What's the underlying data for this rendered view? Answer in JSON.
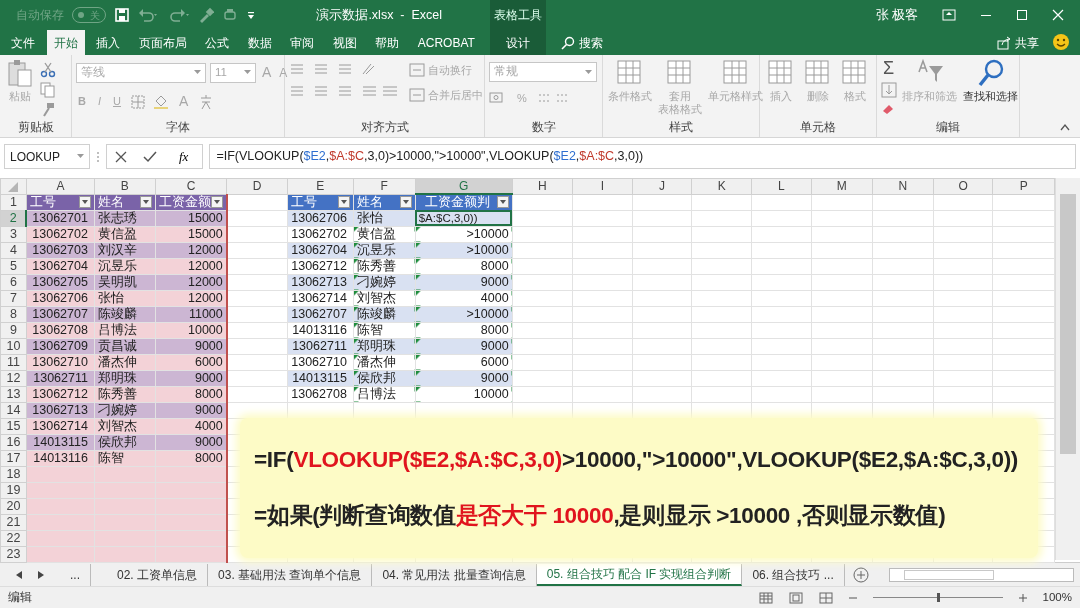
{
  "window": {
    "autosave_label": "自动保存",
    "autosave_state": "关",
    "autosave_on": false,
    "title": "演示数据.xlsx  -  Excel",
    "context_group": "表格工具",
    "user": "张 极客"
  },
  "ribbon_tabs": [
    {
      "label": "文件",
      "selected": false,
      "kind": "normal"
    },
    {
      "label": "开始",
      "selected": true,
      "kind": "normal"
    },
    {
      "label": "插入",
      "selected": false,
      "kind": "normal"
    },
    {
      "label": "页面布局",
      "selected": false,
      "kind": "normal"
    },
    {
      "label": "公式",
      "selected": false,
      "kind": "normal"
    },
    {
      "label": "数据",
      "selected": false,
      "kind": "normal"
    },
    {
      "label": "审阅",
      "selected": false,
      "kind": "normal"
    },
    {
      "label": "视图",
      "selected": false,
      "kind": "normal"
    },
    {
      "label": "帮助",
      "selected": false,
      "kind": "normal"
    },
    {
      "label": "ACROBAT",
      "selected": false,
      "kind": "normal"
    },
    {
      "label": "设计",
      "selected": false,
      "kind": "contextual"
    }
  ],
  "search": "搜索",
  "share": "共享",
  "ribbon_groups": [
    {
      "name": "剪贴板",
      "kind": "clipboard",
      "items": [
        {
          "lines": [
            "粘贴"
          ],
          "disabled": true
        }
      ]
    },
    {
      "name": "字体",
      "kind": "font",
      "font": "等线",
      "size": "11",
      "grow_shrink": [
        "A",
        "A"
      ],
      "styles": [
        "B",
        "I",
        "U"
      ],
      "color_letter": "A",
      "disabled": true
    },
    {
      "name": "对齐方式",
      "kind": "align",
      "items": [
        {
          "lines": [
            "自动换行"
          ],
          "disabled": true
        },
        {
          "lines": [
            "合并后居中"
          ],
          "disabled": true
        }
      ]
    },
    {
      "name": "数字",
      "kind": "number",
      "format": "常规",
      "percent": "%",
      "disabled": true
    },
    {
      "name": "样式",
      "kind": "buttons",
      "items": [
        {
          "lines": [
            "条件格式"
          ],
          "disabled": true
        },
        {
          "lines": [
            "套用",
            "表格格式"
          ],
          "disabled": true
        },
        {
          "lines": [
            "单元格样式"
          ],
          "disabled": true
        }
      ]
    },
    {
      "name": "单元格",
      "kind": "buttons",
      "items": [
        {
          "lines": [
            "插入"
          ],
          "disabled": true
        },
        {
          "lines": [
            "删除"
          ],
          "disabled": true
        },
        {
          "lines": [
            "格式"
          ],
          "disabled": true
        }
      ]
    },
    {
      "name": "编辑",
      "kind": "editing",
      "autosum": "Σ",
      "items": [
        {
          "lines": [
            "排序和筛选"
          ],
          "disabled": true
        },
        {
          "lines": [
            "查找和选择"
          ],
          "disabled": false
        }
      ]
    }
  ],
  "formula_bar": {
    "name_box": "LOOKUP",
    "function_button": "fx",
    "parts": [
      {
        "text": "=IF(VLOOKUP(",
        "kind": "plain"
      },
      {
        "text": "$E2",
        "kind": "ref_blue"
      },
      {
        "text": ",",
        "kind": "plain"
      },
      {
        "text": "$A:$C",
        "kind": "ref_red"
      },
      {
        "text": ",3,0)>10000,\">10000\",VLOOKUP(",
        "kind": "plain"
      },
      {
        "text": "$E2",
        "kind": "ref_blue"
      },
      {
        "text": ",",
        "kind": "plain"
      },
      {
        "text": "$A:$C",
        "kind": "ref_red"
      },
      {
        "text": ",3,0))",
        "kind": "plain"
      }
    ]
  },
  "columns": [
    {
      "label": "A",
      "selected": false
    },
    {
      "label": "B",
      "selected": false
    },
    {
      "label": "C",
      "selected": false
    },
    {
      "label": "D",
      "selected": false
    },
    {
      "label": "E",
      "selected": false
    },
    {
      "label": "F",
      "selected": false
    },
    {
      "label": "G",
      "selected": true
    },
    {
      "label": "H",
      "selected": false
    },
    {
      "label": "I",
      "selected": false
    },
    {
      "label": "J",
      "selected": false
    },
    {
      "label": "K",
      "selected": false
    },
    {
      "label": "L",
      "selected": false
    },
    {
      "label": "M",
      "selected": false
    },
    {
      "label": "N",
      "selected": false
    },
    {
      "label": "O",
      "selected": false
    },
    {
      "label": "P",
      "selected": false
    }
  ],
  "row_headers": [
    {
      "label": "1",
      "selected": false
    },
    {
      "label": "2",
      "selected": true
    },
    {
      "label": "3",
      "selected": false
    },
    {
      "label": "4",
      "selected": false
    },
    {
      "label": "5",
      "selected": false
    },
    {
      "label": "6",
      "selected": false
    },
    {
      "label": "7",
      "selected": false
    },
    {
      "label": "8",
      "selected": false
    },
    {
      "label": "9",
      "selected": false
    },
    {
      "label": "10",
      "selected": false
    },
    {
      "label": "11",
      "selected": false
    },
    {
      "label": "12",
      "selected": false
    },
    {
      "label": "13",
      "selected": false
    },
    {
      "label": "14",
      "selected": false
    },
    {
      "label": "15",
      "selected": false
    },
    {
      "label": "16",
      "selected": false
    },
    {
      "label": "17",
      "selected": false
    },
    {
      "label": "18",
      "selected": false
    },
    {
      "label": "19",
      "selected": false
    },
    {
      "label": "20",
      "selected": false
    },
    {
      "label": "21",
      "selected": false
    },
    {
      "label": "22",
      "selected": false
    },
    {
      "label": "23",
      "selected": false
    }
  ],
  "tables": [
    {
      "columns": [
        "工号",
        "姓名",
        "工资金额"
      ],
      "rows": [
        {
          "cells": [
            "13062701",
            "张志琇",
            "15000"
          ]
        },
        {
          "cells": [
            "13062702",
            "黄信盈",
            "15000"
          ]
        },
        {
          "cells": [
            "13062703",
            "刘汉辛",
            "12000"
          ]
        },
        {
          "cells": [
            "13062704",
            "沉昱乐",
            "12000"
          ]
        },
        {
          "cells": [
            "13062705",
            "吴明凯",
            "12000"
          ]
        },
        {
          "cells": [
            "13062706",
            "张怡",
            "12000"
          ]
        },
        {
          "cells": [
            "13062707",
            "陈竣麟",
            "11000"
          ]
        },
        {
          "cells": [
            "13062708",
            "吕博法",
            "10000"
          ]
        },
        {
          "cells": [
            "13062709",
            "贡昌诚",
            "9000"
          ]
        },
        {
          "cells": [
            "13062710",
            "潘杰伸",
            "6000"
          ]
        },
        {
          "cells": [
            "13062711",
            "郑明珠",
            "9000"
          ]
        },
        {
          "cells": [
            "13062712",
            "陈秀善",
            "8000"
          ]
        },
        {
          "cells": [
            "13062713",
            "刁婉婷",
            "9000"
          ]
        },
        {
          "cells": [
            "13062714",
            "刘智杰",
            "4000"
          ]
        },
        {
          "cells": [
            "14013115",
            "侯欣邦",
            "9000"
          ]
        },
        {
          "cells": [
            "14013116",
            "陈智",
            "8000"
          ]
        }
      ]
    },
    {
      "columns": [
        "工号",
        "姓名",
        "工资金额判"
      ],
      "rows": [
        {
          "cells": [
            "13062706",
            "张怡",
            "$A:$C,3,0))"
          ],
          "flagged": false,
          "editing": true
        },
        {
          "cells": [
            "13062702",
            "黄信盈",
            ">10000"
          ],
          "flagged": true,
          "editing": false
        },
        {
          "cells": [
            "13062704",
            "沉昱乐",
            ">10000"
          ],
          "flagged": true,
          "editing": false
        },
        {
          "cells": [
            "13062712",
            "陈秀善",
            "8000"
          ],
          "flagged": true,
          "editing": false
        },
        {
          "cells": [
            "13062713",
            "刁婉婷",
            "9000"
          ],
          "flagged": true,
          "editing": false
        },
        {
          "cells": [
            "13062714",
            "刘智杰",
            "4000"
          ],
          "flagged": true,
          "editing": false
        },
        {
          "cells": [
            "13062707",
            "陈竣麟",
            ">10000"
          ],
          "flagged": true,
          "editing": false
        },
        {
          "cells": [
            "14013116",
            "陈智",
            "8000"
          ],
          "flagged": true,
          "editing": false
        },
        {
          "cells": [
            "13062711",
            "郑明珠",
            "9000"
          ],
          "flagged": true,
          "editing": false
        },
        {
          "cells": [
            "13062710",
            "潘杰伸",
            "6000"
          ],
          "flagged": true,
          "editing": false
        },
        {
          "cells": [
            "14013115",
            "侯欣邦",
            "9000"
          ],
          "flagged": true,
          "editing": false
        },
        {
          "cells": [
            "13062708",
            "吕博法",
            "10000"
          ],
          "flagged": true,
          "editing": false
        }
      ]
    }
  ],
  "annotation": {
    "lines": [
      [
        {
          "text": "=IF(",
          "emphasis": false
        },
        {
          "text": "VLOOKUP($E2,$A:$C,3,0)",
          "emphasis": true
        },
        {
          "text": ">10000,\">10000\",VLOOKUP($E2,$A:$C,3,0))",
          "emphasis": false
        }
      ],
      [
        {
          "text": "=如果(判断查询数值",
          "emphasis": false
        },
        {
          "text": "是否大于 10000",
          "emphasis": true
        },
        {
          "text": ",是则显示 >10000 ,否则显示数值)",
          "emphasis": false
        }
      ]
    ]
  },
  "sheet_tabs": {
    "overflow": "...",
    "items": [
      {
        "label": "02. 工资单信息",
        "selected": false
      },
      {
        "label": "03. 基础用法 查询单个信息",
        "selected": false
      },
      {
        "label": "04. 常见用法 批量查询信息",
        "selected": false
      },
      {
        "label": "05. 组合技巧 配合 IF 实现组合判断",
        "selected": true
      },
      {
        "label": "06. 组合技巧 ...",
        "selected": false
      }
    ]
  },
  "status_bar": {
    "mode": "编辑",
    "zoom": "100%",
    "zoom_slider": {
      "level": 0.5
    }
  }
}
